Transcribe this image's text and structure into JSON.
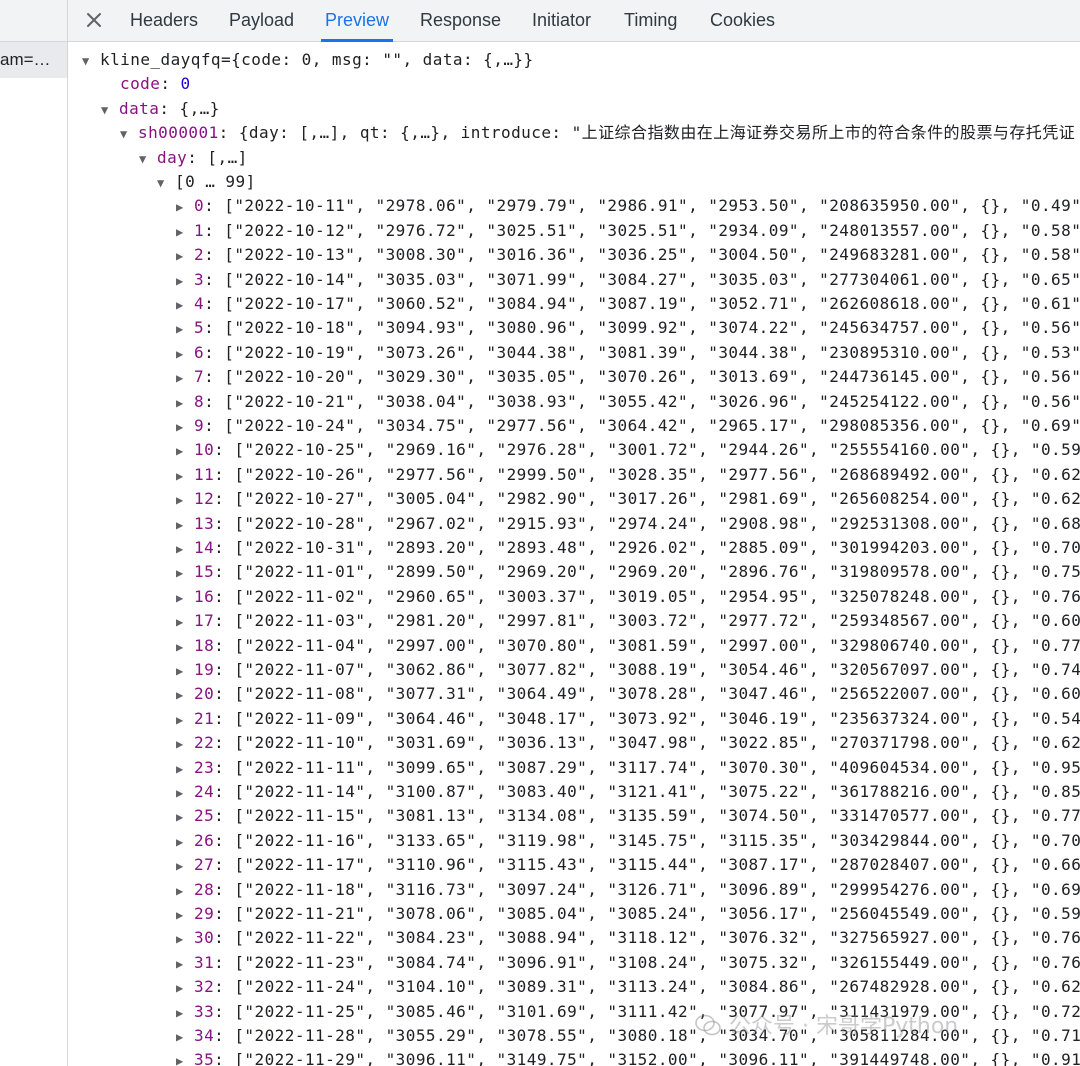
{
  "left_panel": {
    "request_label": "am=…"
  },
  "tabs": [
    {
      "label": "Headers",
      "active": false
    },
    {
      "label": "Payload",
      "active": false
    },
    {
      "label": "Preview",
      "active": true
    },
    {
      "label": "Response",
      "active": false
    },
    {
      "label": "Initiator",
      "active": false
    },
    {
      "label": "Timing",
      "active": false
    },
    {
      "label": "Cookies",
      "active": false
    }
  ],
  "tree": {
    "root": {
      "key": "kline_dayqfq",
      "summary": "={code: 0, msg: \"\", data: {,…}}"
    },
    "code": {
      "key": "code",
      "value": "0"
    },
    "data": {
      "key": "data",
      "summary": ": {,…}"
    },
    "sh": {
      "key": "sh000001",
      "summary": ": {day: [,…], qt: {,…}, introduce: \"上证综合指数由在上海证券交易所上市的符合条件的股票与存托凭证"
    },
    "day": {
      "key": "day",
      "summary": ": [,…]"
    },
    "range": {
      "label": "[0 … 99]"
    },
    "items": [
      [
        "2022-10-11",
        "2978.06",
        "2979.79",
        "2986.91",
        "2953.50",
        "208635950.00",
        "0.49"
      ],
      [
        "2022-10-12",
        "2976.72",
        "3025.51",
        "3025.51",
        "2934.09",
        "248013557.00",
        "0.58"
      ],
      [
        "2022-10-13",
        "3008.30",
        "3016.36",
        "3036.25",
        "3004.50",
        "249683281.00",
        "0.58"
      ],
      [
        "2022-10-14",
        "3035.03",
        "3071.99",
        "3084.27",
        "3035.03",
        "277304061.00",
        "0.65"
      ],
      [
        "2022-10-17",
        "3060.52",
        "3084.94",
        "3087.19",
        "3052.71",
        "262608618.00",
        "0.61"
      ],
      [
        "2022-10-18",
        "3094.93",
        "3080.96",
        "3099.92",
        "3074.22",
        "245634757.00",
        "0.56"
      ],
      [
        "2022-10-19",
        "3073.26",
        "3044.38",
        "3081.39",
        "3044.38",
        "230895310.00",
        "0.53"
      ],
      [
        "2022-10-20",
        "3029.30",
        "3035.05",
        "3070.26",
        "3013.69",
        "244736145.00",
        "0.56"
      ],
      [
        "2022-10-21",
        "3038.04",
        "3038.93",
        "3055.42",
        "3026.96",
        "245254122.00",
        "0.56"
      ],
      [
        "2022-10-24",
        "3034.75",
        "2977.56",
        "3064.42",
        "2965.17",
        "298085356.00",
        "0.69"
      ],
      [
        "2022-10-25",
        "2969.16",
        "2976.28",
        "3001.72",
        "2944.26",
        "255554160.00",
        "0.59"
      ],
      [
        "2022-10-26",
        "2977.56",
        "2999.50",
        "3028.35",
        "2977.56",
        "268689492.00",
        "0.62"
      ],
      [
        "2022-10-27",
        "3005.04",
        "2982.90",
        "3017.26",
        "2981.69",
        "265608254.00",
        "0.62"
      ],
      [
        "2022-10-28",
        "2967.02",
        "2915.93",
        "2974.24",
        "2908.98",
        "292531308.00",
        "0.68"
      ],
      [
        "2022-10-31",
        "2893.20",
        "2893.48",
        "2926.02",
        "2885.09",
        "301994203.00",
        "0.70"
      ],
      [
        "2022-11-01",
        "2899.50",
        "2969.20",
        "2969.20",
        "2896.76",
        "319809578.00",
        "0.75"
      ],
      [
        "2022-11-02",
        "2960.65",
        "3003.37",
        "3019.05",
        "2954.95",
        "325078248.00",
        "0.76"
      ],
      [
        "2022-11-03",
        "2981.20",
        "2997.81",
        "3003.72",
        "2977.72",
        "259348567.00",
        "0.60"
      ],
      [
        "2022-11-04",
        "2997.00",
        "3070.80",
        "3081.59",
        "2997.00",
        "329806740.00",
        "0.77"
      ],
      [
        "2022-11-07",
        "3062.86",
        "3077.82",
        "3088.19",
        "3054.46",
        "320567097.00",
        "0.74"
      ],
      [
        "2022-11-08",
        "3077.31",
        "3064.49",
        "3078.28",
        "3047.46",
        "256522007.00",
        "0.60"
      ],
      [
        "2022-11-09",
        "3064.46",
        "3048.17",
        "3073.92",
        "3046.19",
        "235637324.00",
        "0.54"
      ],
      [
        "2022-11-10",
        "3031.69",
        "3036.13",
        "3047.98",
        "3022.85",
        "270371798.00",
        "0.62"
      ],
      [
        "2022-11-11",
        "3099.65",
        "3087.29",
        "3117.74",
        "3070.30",
        "409604534.00",
        "0.95"
      ],
      [
        "2022-11-14",
        "3100.87",
        "3083.40",
        "3121.41",
        "3075.22",
        "361788216.00",
        "0.85"
      ],
      [
        "2022-11-15",
        "3081.13",
        "3134.08",
        "3135.59",
        "3074.50",
        "331470577.00",
        "0.77"
      ],
      [
        "2022-11-16",
        "3133.65",
        "3119.98",
        "3145.75",
        "3115.35",
        "303429844.00",
        "0.70"
      ],
      [
        "2022-11-17",
        "3110.96",
        "3115.43",
        "3115.44",
        "3087.17",
        "287028407.00",
        "0.66"
      ],
      [
        "2022-11-18",
        "3116.73",
        "3097.24",
        "3126.71",
        "3096.89",
        "299954276.00",
        "0.69"
      ],
      [
        "2022-11-21",
        "3078.06",
        "3085.04",
        "3085.24",
        "3056.17",
        "256045549.00",
        "0.59"
      ],
      [
        "2022-11-22",
        "3084.23",
        "3088.94",
        "3118.12",
        "3076.32",
        "327565927.00",
        "0.76"
      ],
      [
        "2022-11-23",
        "3084.74",
        "3096.91",
        "3108.24",
        "3075.32",
        "326155449.00",
        "0.76"
      ],
      [
        "2022-11-24",
        "3104.10",
        "3089.31",
        "3113.24",
        "3084.86",
        "267482928.00",
        "0.62"
      ],
      [
        "2022-11-25",
        "3085.46",
        "3101.69",
        "3111.42",
        "3077.97",
        "311431979.00",
        "0.72"
      ],
      [
        "2022-11-28",
        "3055.29",
        "3078.55",
        "3080.18",
        "3034.70",
        "305811284.00",
        "0.71"
      ],
      [
        "2022-11-29",
        "3096.11",
        "3149.75",
        "3152.00",
        "3096.11",
        "391449748.00",
        "0.91"
      ]
    ]
  },
  "watermark": {
    "text": "公众号 · 宋哥学Python"
  }
}
